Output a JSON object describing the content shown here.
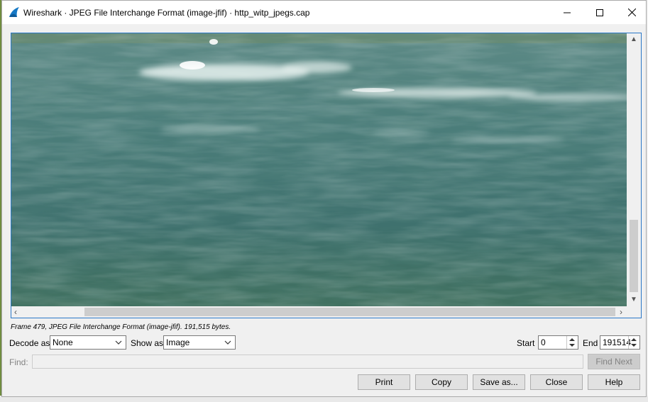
{
  "window": {
    "title": "Wireshark · JPEG File Interchange Format (image-jfif) · http_witp_jpegs.cap",
    "controls": [
      "minimize",
      "maximize",
      "close"
    ]
  },
  "viewer": {
    "content": "decoded JPEG image of water surface",
    "vscroll_position": 0.75,
    "hscroll_position": 0.12
  },
  "status": {
    "frame_info": "Frame 479, JPEG File Interchange Format (image-jfif). 191,515 bytes."
  },
  "controls": {
    "decode_as_label": "Decode as",
    "decode_as_value": "None",
    "show_as_label": "Show as",
    "show_as_value": "Image",
    "start_label": "Start",
    "start_value": "0",
    "end_label": "End",
    "end_value": "191514"
  },
  "find": {
    "label": "Find:",
    "value": "",
    "find_next_label": "Find Next"
  },
  "buttons": {
    "print": "Print",
    "copy": "Copy",
    "save_as": "Save as...",
    "close": "Close",
    "help": "Help"
  },
  "colors": {
    "accent_border": "#2a78c8",
    "water_dark": "#3f6f6c",
    "water_light": "#6a9a97"
  }
}
